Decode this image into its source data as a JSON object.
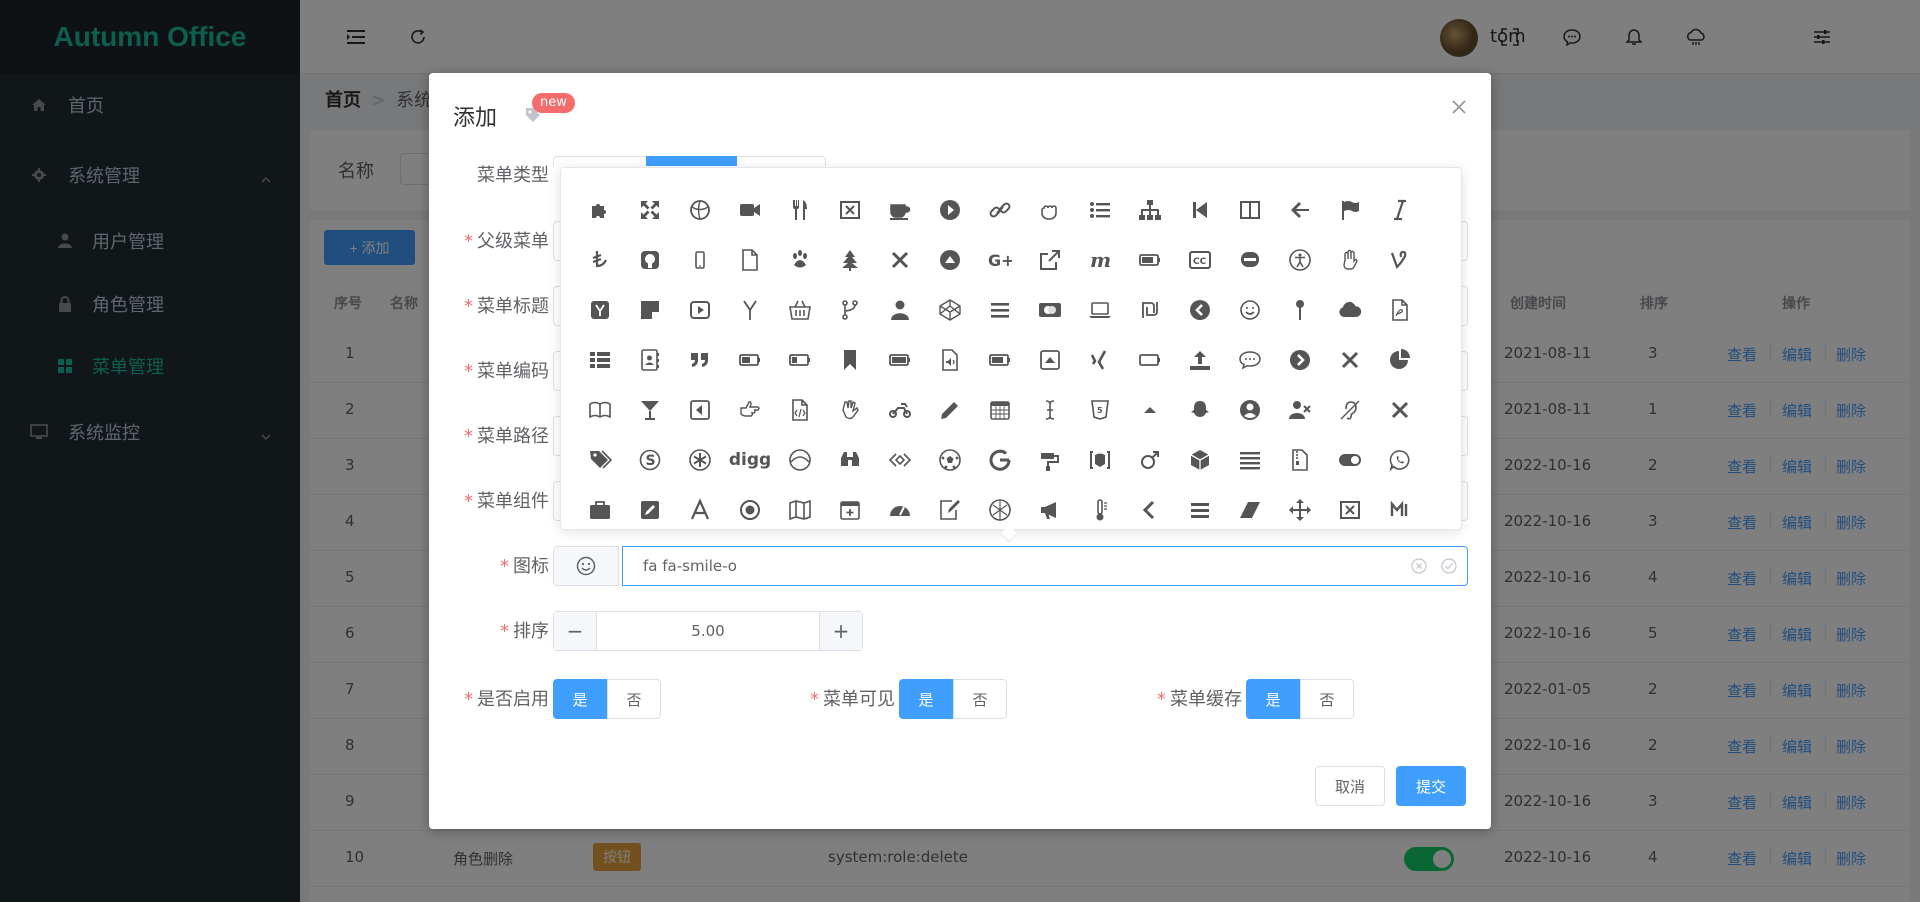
{
  "app": {
    "brand": "Autumn Office",
    "user": "tom"
  },
  "sidebar": {
    "items": [
      {
        "label": "首页",
        "icon": "home-icon"
      },
      {
        "label": "系统管理",
        "icon": "gear-icon",
        "children": [
          {
            "label": "用户管理",
            "icon": "user-icon"
          },
          {
            "label": "角色管理",
            "icon": "lock-icon"
          },
          {
            "label": "菜单管理",
            "icon": "grid-icon",
            "active": true
          }
        ]
      },
      {
        "label": "系统监控",
        "icon": "monitor-icon"
      }
    ]
  },
  "breadcrumb": {
    "first": "首页",
    "second": "系统"
  },
  "search": {
    "label": "名称"
  },
  "toolbar": {
    "add_label": "+ 添加"
  },
  "table": {
    "headers": [
      "序号",
      "名称",
      "创建时间",
      "排序",
      "操作"
    ],
    "rows": [
      {
        "no": "1",
        "date": "2021-08-11",
        "sort": "3"
      },
      {
        "no": "2",
        "date": "2021-08-11",
        "sort": "1"
      },
      {
        "no": "3",
        "date": "2022-10-16",
        "sort": "2"
      },
      {
        "no": "4",
        "date": "2022-10-16",
        "sort": "3"
      },
      {
        "no": "5",
        "date": "2022-10-16",
        "sort": "4"
      },
      {
        "no": "6",
        "date": "2022-10-16",
        "sort": "5"
      },
      {
        "no": "7",
        "date": "2022-01-05",
        "sort": "2"
      },
      {
        "no": "8",
        "date": "2022-10-16",
        "sort": "2"
      },
      {
        "no": "9",
        "date": "2022-10-16",
        "sort": "3"
      },
      {
        "no": "10",
        "name": "角色删除",
        "type": "按钮",
        "perm": "system:role:delete",
        "date": "2022-10-16",
        "sort": "4"
      }
    ],
    "ops": {
      "view": "查看",
      "edit": "编辑",
      "delete": "删除"
    }
  },
  "dialog": {
    "title": "添加",
    "badge": "new",
    "labels": {
      "menu_type": "菜单类型",
      "parent": "父级菜单",
      "title": "菜单标题",
      "code": "菜单编码",
      "path": "菜单路径",
      "component": "菜单组件",
      "icon": "图标",
      "sort": "排序",
      "enabled": "是否启用",
      "visible": "菜单可见",
      "cache": "菜单缓存"
    },
    "icon_value": "fa fa-smile-o",
    "sort_value": "5.00",
    "yes": "是",
    "no": "否",
    "cancel": "取消",
    "submit": "提交"
  },
  "picker": {
    "text_icons": {
      "digg": "digg"
    }
  },
  "colors": {
    "primary": "#409eff",
    "brand": "#1abc9c",
    "sidebar": "#222d32",
    "danger": "#f56c6c"
  }
}
